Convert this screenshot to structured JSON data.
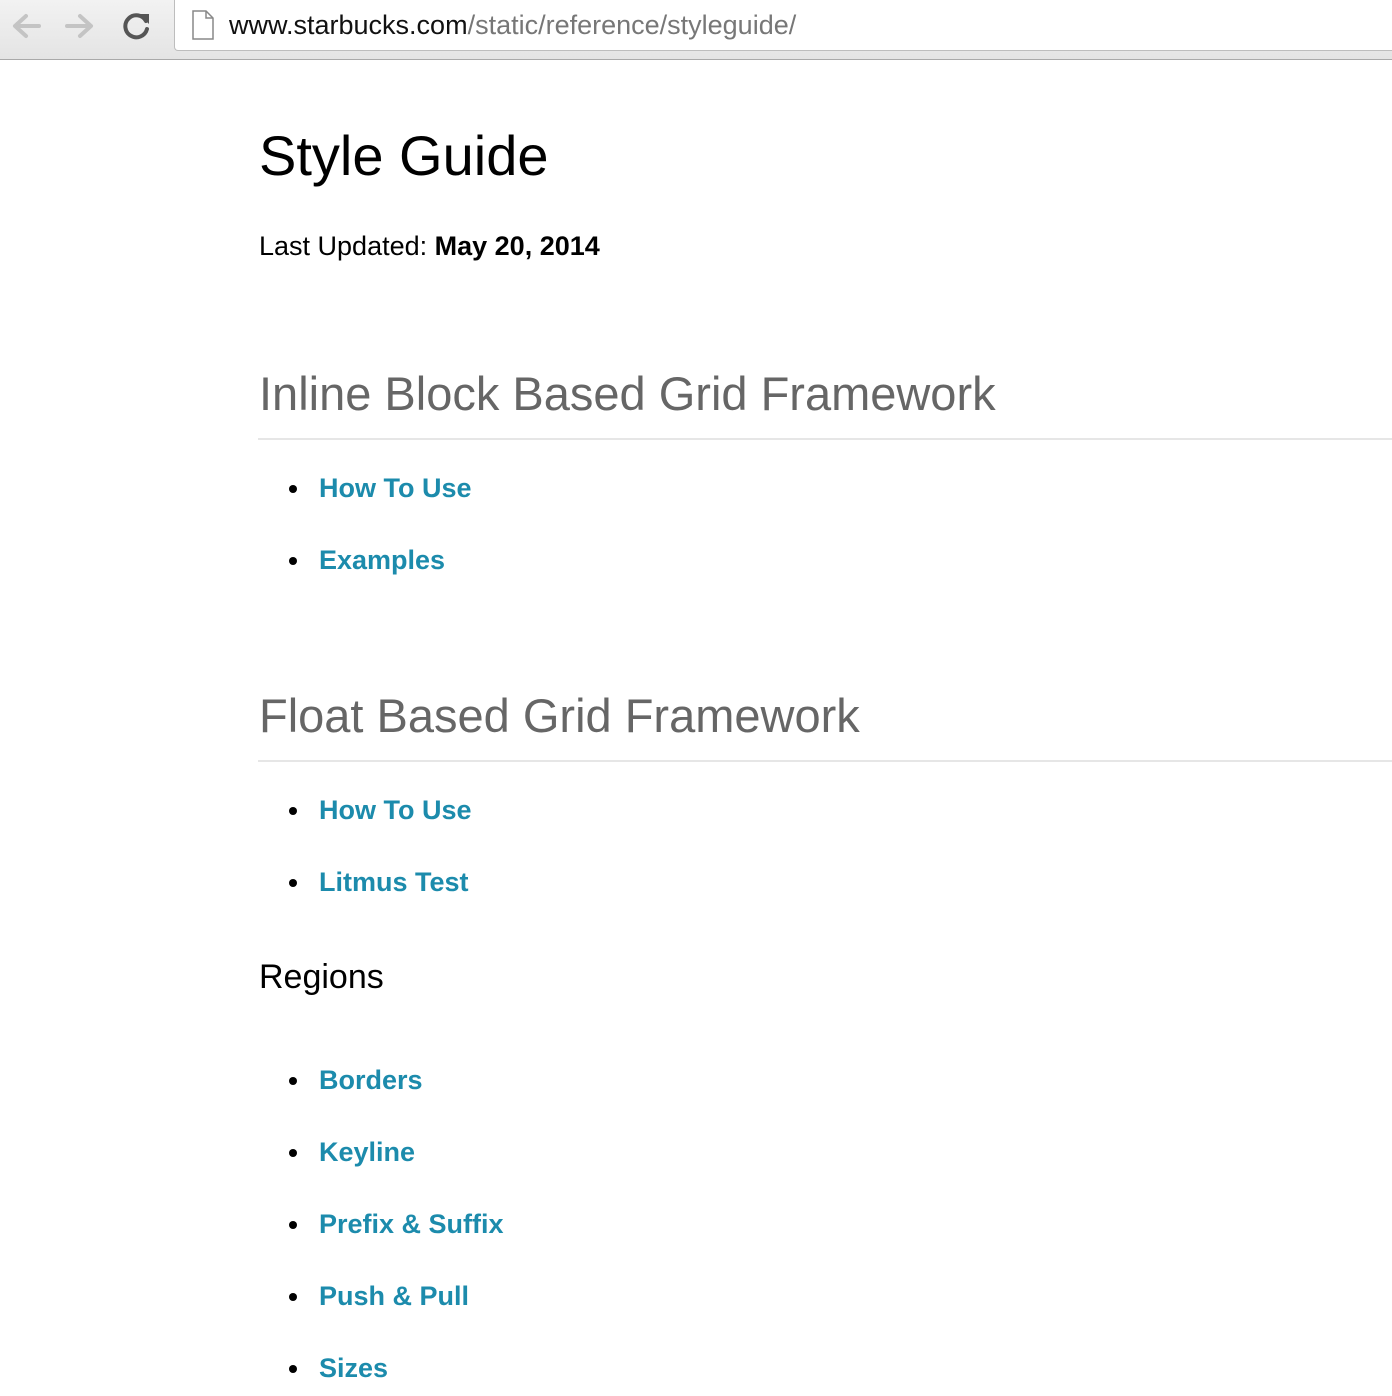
{
  "browser": {
    "url_domain": "www.starbucks.com",
    "url_path": "/static/reference/styleguide/"
  },
  "page": {
    "title": "Style Guide",
    "updated_label": "Last Updated:",
    "updated_date": "May 20, 2014"
  },
  "sections": [
    {
      "title": "Inline Block Based Grid Framework",
      "links": [
        "How To Use",
        "Examples"
      ]
    },
    {
      "title": "Float Based Grid Framework",
      "links": [
        "How To Use",
        "Litmus Test"
      ],
      "subsection": {
        "title": "Regions",
        "links": [
          "Borders",
          "Keyline",
          "Prefix & Suffix",
          "Push & Pull",
          "Sizes"
        ]
      }
    }
  ],
  "colors": {
    "link": "#1c8bac",
    "section_title": "#666666"
  },
  "icons": {
    "back": "back-arrow-icon",
    "forward": "forward-arrow-icon",
    "reload": "reload-icon",
    "page": "page-icon"
  }
}
